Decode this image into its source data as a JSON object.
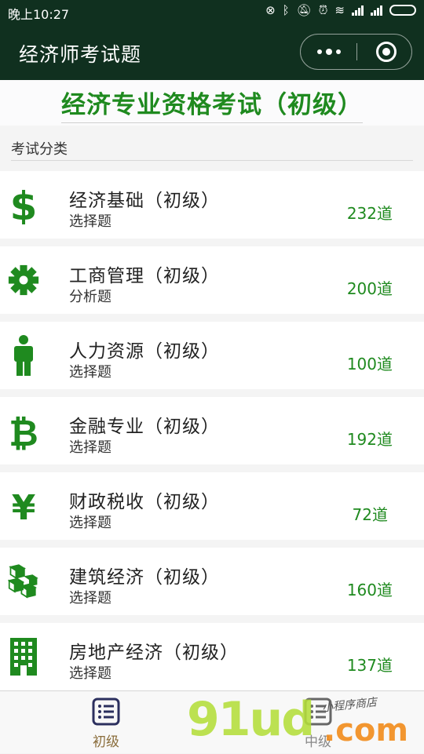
{
  "status_bar": {
    "time": "晚上10:27"
  },
  "nav": {
    "title": "经济师考试题"
  },
  "banner": {
    "title": "经济专业资格考试（初级）"
  },
  "section": {
    "label": "考试分类"
  },
  "categories": [
    {
      "name": "经济基础（初级）",
      "type": "选择题",
      "count": "232道",
      "icon": "dollar-icon"
    },
    {
      "name": "工商管理（初级）",
      "type": "分析题",
      "count": "200道",
      "icon": "gear-icon"
    },
    {
      "name": "人力资源（初级）",
      "type": "选择题",
      "count": "100道",
      "icon": "person-icon"
    },
    {
      "name": "金融专业（初级）",
      "type": "选择题",
      "count": "192道",
      "icon": "bitcoin-icon"
    },
    {
      "name": "财政税收（初级）",
      "type": "选择题",
      "count": "72道",
      "icon": "yen-icon"
    },
    {
      "name": "建筑经济（初级）",
      "type": "选择题",
      "count": "160道",
      "icon": "cubes-icon"
    },
    {
      "name": "房地产经济（初级）",
      "type": "选择题",
      "count": "137道",
      "icon": "building-icon"
    }
  ],
  "tabs": [
    {
      "label": "初级",
      "icon": "list-icon",
      "active": true
    },
    {
      "label": "中级",
      "icon": "list-icon",
      "active": false
    }
  ],
  "watermark": {
    "brand": "91ud",
    "domain": ".com",
    "slogan": "小程序商店"
  },
  "colors": {
    "navbar": "#10301f",
    "accent_green": "#1f8a1f",
    "active_tab": "#8a6d3b"
  }
}
